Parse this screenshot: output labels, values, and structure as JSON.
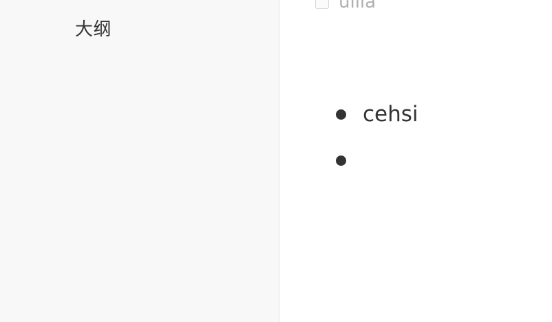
{
  "sidebar": {
    "title": "大纲"
  },
  "editor": {
    "top_item": {
      "text": "ullia"
    },
    "bullets": [
      {
        "text": "cehsi"
      },
      {
        "text": ""
      }
    ]
  }
}
